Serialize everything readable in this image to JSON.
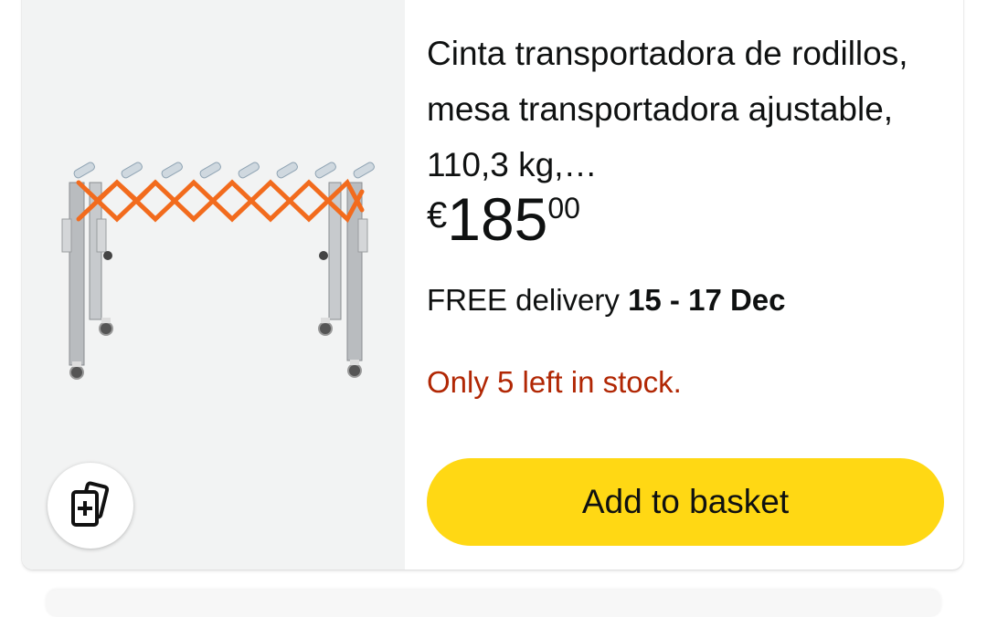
{
  "product": {
    "title": "Cinta transportadora de rodillos, mesa transportadora ajustable, 110,3 kg,…",
    "price": {
      "currency": "€",
      "whole": "185",
      "fraction": "00"
    },
    "delivery": {
      "prefix": "FREE delivery",
      "dates": "15 - 17 Dec"
    },
    "stock": "Only 5 left in stock.",
    "add_button": "Add to basket",
    "compare_icon": "compare-cards-icon",
    "image_icon": "roller-conveyor-product-image"
  },
  "colors": {
    "add_button": "#ffd814",
    "stock_text": "#b12704",
    "image_bg": "#f2f3f3",
    "conveyor_accent": "#f26b1d"
  }
}
